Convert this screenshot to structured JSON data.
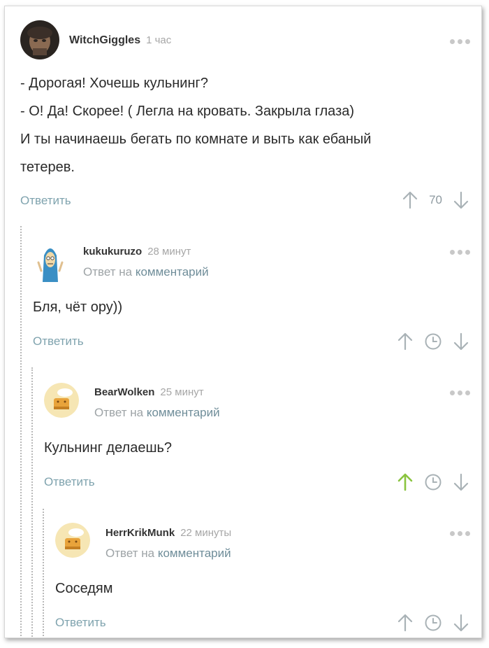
{
  "comments": [
    {
      "username": "WitchGiggles",
      "time": "1 час",
      "lines": [
        "- Дорогая! Хочешь кульнинг?",
        "- О! Да! Скорее! ( Легла на кровать. Закрыла глаза)",
        "И ты начинаешь бегать по комнате и выть как ебаный",
        "тетерев."
      ],
      "reply_label": "Ответить",
      "score": "70"
    },
    {
      "username": "kukukuruzo",
      "time": "28 минут",
      "reply_to_prefix": "Ответ на",
      "reply_to_link": "комментарий",
      "text": "Бля, чёт ору))",
      "reply_label": "Ответить"
    },
    {
      "username": "BearWolken",
      "time": "25 минут",
      "reply_to_prefix": "Ответ на",
      "reply_to_link": "комментарий",
      "text": "Кульнинг делаешь?",
      "reply_label": "Ответить",
      "upvoted": true
    },
    {
      "username": "HerrKrikMunk",
      "time": "22 минуты",
      "reply_to_prefix": "Ответ на",
      "reply_to_link": "комментарий",
      "text": "Соседям",
      "reply_label": "Ответить"
    }
  ],
  "colors": {
    "accent": "#7fa3ae",
    "upvote_active": "#8ac43f",
    "icon_gray": "#a9b2b6"
  },
  "icons": [
    "more-dots-icon",
    "upvote-arrow-icon",
    "downvote-arrow-icon",
    "clock-icon"
  ]
}
